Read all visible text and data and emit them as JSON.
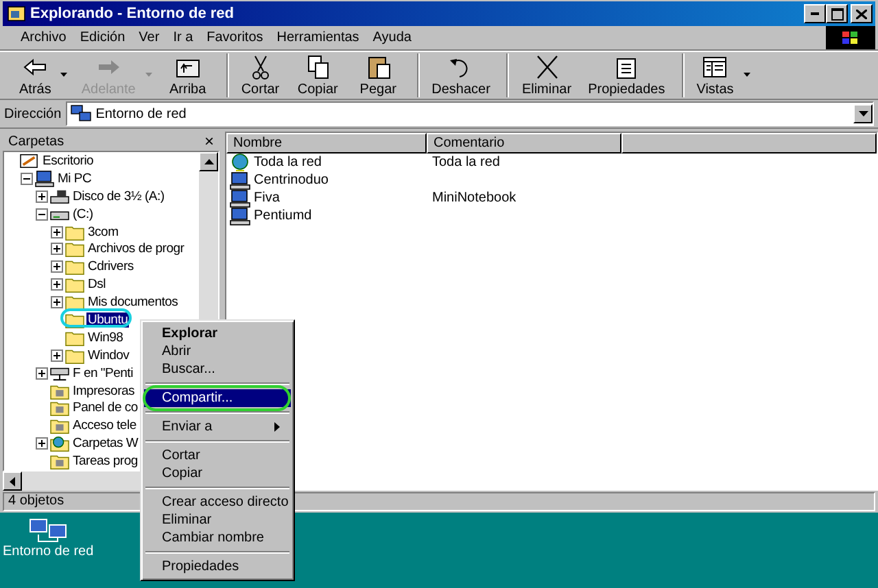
{
  "window": {
    "title": "Explorando - Entorno de red"
  },
  "menu": [
    "Archivo",
    "Edición",
    "Ver",
    "Ir a",
    "Favoritos",
    "Herramientas",
    "Ayuda"
  ],
  "toolbar": [
    {
      "label": "Atrás",
      "kind": "back",
      "dropdown": true,
      "disabled": false,
      "group_start": false
    },
    {
      "label": "Adelante",
      "kind": "forward",
      "dropdown": true,
      "disabled": true,
      "group_start": false
    },
    {
      "label": "Arriba",
      "kind": "up",
      "dropdown": false,
      "disabled": false,
      "group_start": false
    },
    {
      "label": "Cortar",
      "kind": "cut",
      "dropdown": false,
      "disabled": false,
      "group_start": true
    },
    {
      "label": "Copiar",
      "kind": "copy",
      "dropdown": false,
      "disabled": false,
      "group_start": false
    },
    {
      "label": "Pegar",
      "kind": "paste",
      "dropdown": false,
      "disabled": false,
      "group_start": false
    },
    {
      "label": "Deshacer",
      "kind": "undo",
      "dropdown": false,
      "disabled": false,
      "group_start": true
    },
    {
      "label": "Eliminar",
      "kind": "delete",
      "dropdown": false,
      "disabled": false,
      "group_start": true
    },
    {
      "label": "Propiedades",
      "kind": "properties",
      "dropdown": false,
      "disabled": false,
      "group_start": false
    },
    {
      "label": "Vistas",
      "kind": "views",
      "dropdown": true,
      "disabled": false,
      "group_start": true
    }
  ],
  "address": {
    "label": "Dirección",
    "value": "Entorno de red"
  },
  "folders_pane": {
    "title": "Carpetas",
    "close": "×"
  },
  "tree": [
    {
      "label": "Escritorio",
      "kind": "desktop",
      "children": [
        {
          "label": "Mi PC",
          "kind": "computer",
          "expanded": true,
          "children": [
            {
              "label": "Disco de 3½ (A:)",
              "kind": "floppy",
              "expanded": false
            },
            {
              "label": "(C:)",
              "kind": "drive",
              "expanded": true,
              "children": [
                {
                  "label": "3com",
                  "kind": "folder",
                  "expanded": false
                },
                {
                  "label": "Archivos de progr",
                  "kind": "folder",
                  "expanded": false
                },
                {
                  "label": "Cdrivers",
                  "kind": "folder",
                  "expanded": false
                },
                {
                  "label": "Dsl",
                  "kind": "folder",
                  "expanded": false
                },
                {
                  "label": "Mis documentos",
                  "kind": "folder",
                  "expanded": false
                },
                {
                  "label": "Ubuntu",
                  "kind": "folder",
                  "selected": true
                },
                {
                  "label": "Win98",
                  "kind": "folder",
                  "selected": false
                },
                {
                  "label": "Windov",
                  "kind": "folder",
                  "expanded": false
                }
              ]
            },
            {
              "label": "F en \"Penti",
              "kind": "netdrive",
              "expanded": false
            },
            {
              "label": "Impresoras",
              "kind": "special",
              "selected": false
            },
            {
              "label": "Panel de co",
              "kind": "special",
              "selected": false
            },
            {
              "label": "Acceso tele",
              "kind": "special",
              "selected": false
            },
            {
              "label": "Carpetas W",
              "kind": "globe",
              "expanded": false
            },
            {
              "label": "Tareas prog",
              "kind": "special",
              "selected": false
            }
          ]
        }
      ]
    }
  ],
  "table": {
    "columns": [
      "Nombre",
      "Comentario"
    ],
    "rows": [
      {
        "name": "Toda la red",
        "comment": "Toda la red",
        "kind": "globe"
      },
      {
        "name": "Centrinoduo",
        "kind": "computer"
      },
      {
        "name": "Fiva",
        "comment": "MiniNotebook",
        "kind": "computer"
      },
      {
        "name": "Pentiumd",
        "kind": "computer"
      }
    ]
  },
  "context_menu": [
    {
      "kind": "item",
      "label": "Explorar",
      "default": true,
      "selected": false
    },
    {
      "kind": "item",
      "label": "Abrir",
      "default": false,
      "selected": false
    },
    {
      "kind": "item",
      "label": "Buscar...",
      "default": false,
      "selected": false
    },
    {
      "kind": "separator"
    },
    {
      "kind": "item",
      "label": "Compartir...",
      "default": false,
      "selected": true
    },
    {
      "kind": "separator"
    },
    {
      "kind": "submenu",
      "label": "Enviar a",
      "default": false,
      "selected": false
    },
    {
      "kind": "separator"
    },
    {
      "kind": "item",
      "label": "Cortar",
      "default": false,
      "selected": false
    },
    {
      "kind": "item",
      "label": "Copiar",
      "default": false,
      "selected": false
    },
    {
      "kind": "separator"
    },
    {
      "kind": "item",
      "label": "Crear acceso directo",
      "default": false,
      "selected": false
    },
    {
      "kind": "item",
      "label": "Eliminar",
      "default": false,
      "selected": false
    },
    {
      "kind": "item",
      "label": "Cambiar nombre",
      "default": false,
      "selected": false
    },
    {
      "kind": "separator"
    },
    {
      "kind": "item",
      "label": "Propiedades",
      "default": false,
      "selected": false
    }
  ],
  "status_bar": {
    "text": "4 objetos"
  },
  "desktop_icons": [
    {
      "label": "Entorno de red"
    }
  ]
}
